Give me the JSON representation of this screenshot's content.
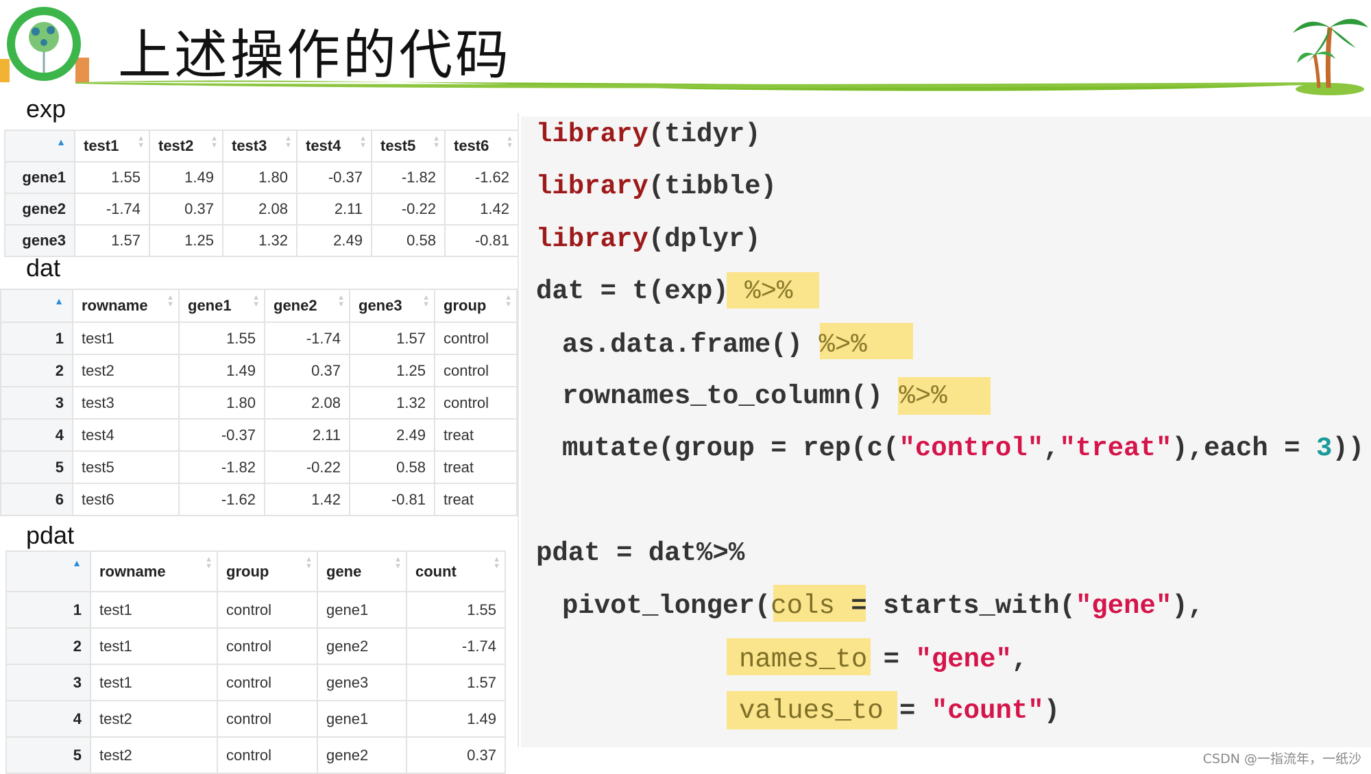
{
  "header": {
    "title": "上述操作的代码"
  },
  "exp": {
    "label": "exp",
    "columns": [
      "",
      "test1",
      "test2",
      "test3",
      "test4",
      "test5",
      "test6"
    ],
    "rows": [
      [
        "gene1",
        "1.55",
        "1.49",
        "1.80",
        "-0.37",
        "-1.82",
        "-1.62"
      ],
      [
        "gene2",
        "-1.74",
        "0.37",
        "2.08",
        "2.11",
        "-0.22",
        "1.42"
      ],
      [
        "gene3",
        "1.57",
        "1.25",
        "1.32",
        "2.49",
        "0.58",
        "-0.81"
      ]
    ]
  },
  "dat": {
    "label": "dat",
    "columns": [
      "",
      "rowname",
      "gene1",
      "gene2",
      "gene3",
      "group"
    ],
    "rows": [
      [
        "1",
        "test1",
        "1.55",
        "-1.74",
        "1.57",
        "control"
      ],
      [
        "2",
        "test2",
        "1.49",
        "0.37",
        "1.25",
        "control"
      ],
      [
        "3",
        "test3",
        "1.80",
        "2.08",
        "1.32",
        "control"
      ],
      [
        "4",
        "test4",
        "-0.37",
        "2.11",
        "2.49",
        "treat"
      ],
      [
        "5",
        "test5",
        "-1.82",
        "-0.22",
        "0.58",
        "treat"
      ],
      [
        "6",
        "test6",
        "-1.62",
        "1.42",
        "-0.81",
        "treat"
      ]
    ]
  },
  "pdat": {
    "label": "pdat",
    "columns": [
      "",
      "rowname",
      "group",
      "gene",
      "count"
    ],
    "rows": [
      [
        "1",
        "test1",
        "control",
        "gene1",
        "1.55"
      ],
      [
        "2",
        "test1",
        "control",
        "gene2",
        "-1.74"
      ],
      [
        "3",
        "test1",
        "control",
        "gene3",
        "1.57"
      ],
      [
        "4",
        "test2",
        "control",
        "gene1",
        "1.49"
      ],
      [
        "5",
        "test2",
        "control",
        "gene2",
        "0.37"
      ]
    ]
  },
  "code": {
    "lines": [
      [
        {
          "t": "library",
          "c": "kw"
        },
        {
          "t": "(tidyr)"
        }
      ],
      [
        {
          "t": "library",
          "c": "kw"
        },
        {
          "t": "(tibble)"
        }
      ],
      [
        {
          "t": "library",
          "c": "kw"
        },
        {
          "t": "(dplyr)"
        }
      ],
      [
        {
          "t": "dat = t(exp) "
        },
        {
          "t": "%>%",
          "c": "op"
        }
      ],
      [
        {
          "t": "as.data.frame() "
        },
        {
          "t": "%>%",
          "c": "op"
        }
      ],
      [
        {
          "t": "rownames_to_column() "
        },
        {
          "t": "%>%",
          "c": "op"
        }
      ],
      [
        {
          "t": "mutate(group = rep(c("
        },
        {
          "t": "\"control\"",
          "c": "str"
        },
        {
          "t": ","
        },
        {
          "t": "\"treat\"",
          "c": "str"
        },
        {
          "t": "),each = "
        },
        {
          "t": "3",
          "c": "numc"
        },
        {
          "t": "))"
        }
      ],
      [
        {
          "t": "pdat = dat%>%"
        }
      ],
      [
        {
          "t": "pivot_longer("
        },
        {
          "t": "cols",
          "c": "hlt"
        },
        {
          "t": " = starts_with("
        },
        {
          "t": "\"gene\"",
          "c": "str"
        },
        {
          "t": "),"
        }
      ],
      [
        {
          "t": "names_to",
          "c": "hlt"
        },
        {
          "t": " = "
        },
        {
          "t": "\"gene\"",
          "c": "str"
        },
        {
          "t": ","
        }
      ],
      [
        {
          "t": "values_to",
          "c": "hlt"
        },
        {
          "t": " = "
        },
        {
          "t": "\"count\"",
          "c": "str"
        },
        {
          "t": ")"
        }
      ]
    ]
  },
  "colors": {
    "highlight": "#fae48c",
    "keyword": "#9e1a1a",
    "string": "#d5144a",
    "number": "#1a9a9a",
    "sort_active": "#2b8bd6"
  },
  "watermark": "CSDN @一指流年，一纸沙"
}
